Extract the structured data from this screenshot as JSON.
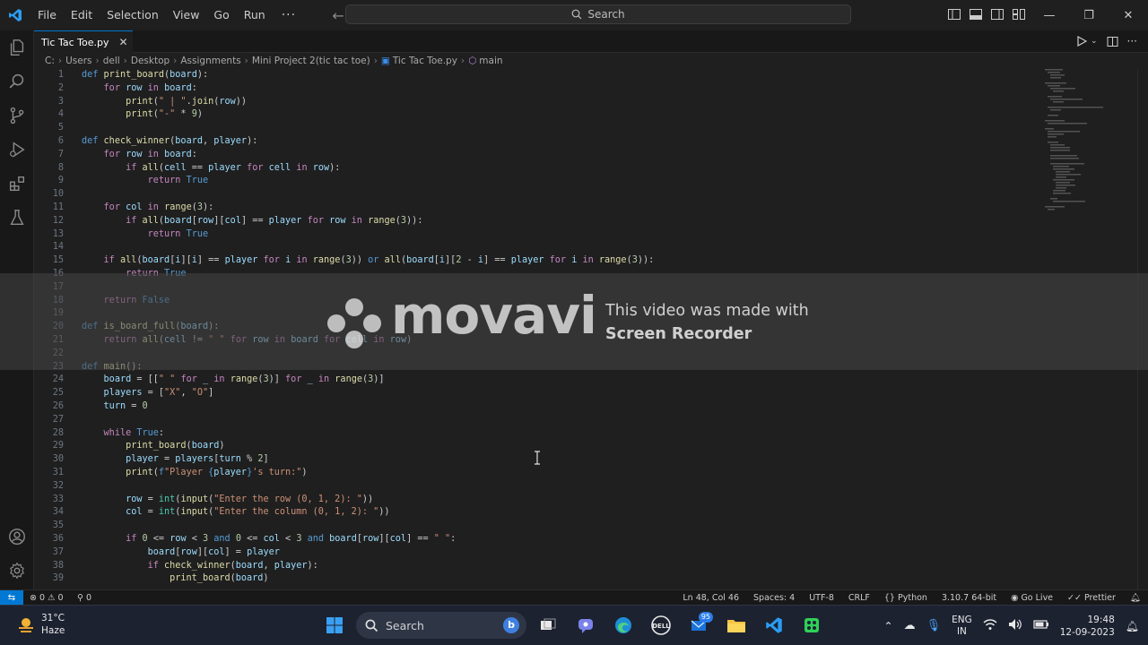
{
  "menu": [
    "File",
    "Edit",
    "Selection",
    "View",
    "Go",
    "Run"
  ],
  "menu_more": "···",
  "search_label": "Search",
  "tab": {
    "title": "Tic Tac Toe.py",
    "close": "✕"
  },
  "breadcrumb": [
    "C:",
    "Users",
    "dell",
    "Desktop",
    "Assignments",
    "Mini Project 2(tic tac toe)",
    "Tic Tac Toe.py",
    "main"
  ],
  "code_lines": [
    {
      "n": "1",
      "html": "<span class='kw'>def</span> <span class='fn'>print_board</span>(<span class='var'>board</span>):"
    },
    {
      "n": "2",
      "html": "    <span class='ctl'>for</span> <span class='var'>row</span> <span class='ctl'>in</span> <span class='var'>board</span>:"
    },
    {
      "n": "3",
      "html": "        <span class='fn'>print</span>(<span class='str'>\" | \"</span>.<span class='fn'>join</span>(<span class='var'>row</span>))"
    },
    {
      "n": "4",
      "html": "        <span class='fn'>print</span>(<span class='str'>\"-\"</span> * <span class='num'>9</span>)"
    },
    {
      "n": "5",
      "html": ""
    },
    {
      "n": "6",
      "html": "<span class='kw'>def</span> <span class='fn'>check_winner</span>(<span class='var'>board</span>, <span class='var'>player</span>):"
    },
    {
      "n": "7",
      "html": "    <span class='ctl'>for</span> <span class='var'>row</span> <span class='ctl'>in</span> <span class='var'>board</span>:"
    },
    {
      "n": "8",
      "html": "        <span class='ctl'>if</span> <span class='fn'>all</span>(<span class='var'>cell</span> == <span class='var'>player</span> <span class='ctl'>for</span> <span class='var'>cell</span> <span class='ctl'>in</span> <span class='var'>row</span>):"
    },
    {
      "n": "9",
      "html": "            <span class='ctl'>return</span> <span class='kw'>True</span>"
    },
    {
      "n": "10",
      "html": ""
    },
    {
      "n": "11",
      "html": "    <span class='ctl'>for</span> <span class='var'>col</span> <span class='ctl'>in</span> <span class='fn'>range</span>(<span class='num'>3</span>):"
    },
    {
      "n": "12",
      "html": "        <span class='ctl'>if</span> <span class='fn'>all</span>(<span class='var'>board</span>[<span class='var'>row</span>][<span class='var'>col</span>] == <span class='var'>player</span> <span class='ctl'>for</span> <span class='var'>row</span> <span class='ctl'>in</span> <span class='fn'>range</span>(<span class='num'>3</span>)):"
    },
    {
      "n": "13",
      "html": "            <span class='ctl'>return</span> <span class='kw'>True</span>"
    },
    {
      "n": "14",
      "html": ""
    },
    {
      "n": "15",
      "html": "    <span class='ctl'>if</span> <span class='fn'>all</span>(<span class='var'>board</span>[<span class='var'>i</span>][<span class='var'>i</span>] == <span class='var'>player</span> <span class='ctl'>for</span> <span class='var'>i</span> <span class='ctl'>in</span> <span class='fn'>range</span>(<span class='num'>3</span>)) <span class='kw'>or</span> <span class='fn'>all</span>(<span class='var'>board</span>[<span class='var'>i</span>][<span class='num'>2</span> - <span class='var'>i</span>] == <span class='var'>player</span> <span class='ctl'>for</span> <span class='var'>i</span> <span class='ctl'>in</span> <span class='fn'>range</span>(<span class='num'>3</span>)):"
    },
    {
      "n": "16",
      "html": "        <span class='ctl'>return</span> <span class='kw'>True</span>"
    },
    {
      "n": "17",
      "html": ""
    },
    {
      "n": "18",
      "html": "    <span class='ctl'>return</span> <span class='kw'>False</span>"
    },
    {
      "n": "19",
      "html": ""
    },
    {
      "n": "20",
      "html": "<span class='kw'>def</span> <span class='fn'>is_board_full</span>(<span class='var'>board</span>):"
    },
    {
      "n": "21",
      "html": "    <span class='ctl'>return</span> <span class='fn'>all</span>(<span class='var'>cell</span> != <span class='str'>\" \"</span> <span class='ctl'>for</span> <span class='var'>row</span> <span class='ctl'>in</span> <span class='var'>board</span> <span class='ctl'>for</span> <span class='var'>cell</span> <span class='ctl'>in</span> <span class='var'>row</span>)"
    },
    {
      "n": "22",
      "html": ""
    },
    {
      "n": "23",
      "html": "<span class='kw'>def</span> <span class='fn'>main</span>():"
    },
    {
      "n": "24",
      "html": "    <span class='var'>board</span> = [[<span class='str'>\" \"</span> <span class='ctl'>for</span> <span class='var'>_</span> <span class='ctl'>in</span> <span class='fn'>range</span>(<span class='num'>3</span>)] <span class='ctl'>for</span> <span class='var'>_</span> <span class='ctl'>in</span> <span class='fn'>range</span>(<span class='num'>3</span>)]"
    },
    {
      "n": "25",
      "html": "    <span class='var'>players</span> = [<span class='str'>\"X\"</span>, <span class='str'>\"O\"</span>]"
    },
    {
      "n": "26",
      "html": "    <span class='var'>turn</span> = <span class='num'>0</span>"
    },
    {
      "n": "27",
      "html": ""
    },
    {
      "n": "28",
      "html": "    <span class='ctl'>while</span> <span class='kw'>True</span>:"
    },
    {
      "n": "29",
      "html": "        <span class='fn'>print_board</span>(<span class='var'>board</span>)"
    },
    {
      "n": "30",
      "html": "        <span class='var'>player</span> = <span class='var'>players</span>[<span class='var'>turn</span> % <span class='num'>2</span>]"
    },
    {
      "n": "31",
      "html": "        <span class='fn'>print</span>(<span class='kw'>f</span><span class='str'>\"Player </span><span class='kw'>{</span><span class='var'>player</span><span class='kw'>}</span><span class='str'>'s turn:\"</span>)"
    },
    {
      "n": "32",
      "html": ""
    },
    {
      "n": "33",
      "html": "        <span class='var'>row</span> = <span class='cls'>int</span>(<span class='fn'>input</span>(<span class='str'>\"Enter the row (0, 1, 2): \"</span>))"
    },
    {
      "n": "34",
      "html": "        <span class='var'>col</span> = <span class='cls'>int</span>(<span class='fn'>input</span>(<span class='str'>\"Enter the column (0, 1, 2): \"</span>))"
    },
    {
      "n": "35",
      "html": ""
    },
    {
      "n": "36",
      "html": "        <span class='ctl'>if</span> <span class='num'>0</span> &lt;= <span class='var'>row</span> &lt; <span class='num'>3</span> <span class='kw'>and</span> <span class='num'>0</span> &lt;= <span class='var'>col</span> &lt; <span class='num'>3</span> <span class='kw'>and</span> <span class='var'>board</span>[<span class='var'>row</span>][<span class='var'>col</span>] == <span class='str'>\" \"</span>:"
    },
    {
      "n": "37",
      "html": "            <span class='var'>board</span>[<span class='var'>row</span>][<span class='var'>col</span>] = <span class='var'>player</span>"
    },
    {
      "n": "38",
      "html": "            <span class='ctl'>if</span> <span class='fn'>check_winner</span>(<span class='var'>board</span>, <span class='var'>player</span>):"
    },
    {
      "n": "39",
      "html": "                <span class='fn'>print_board</span>(<span class='var'>board</span>)"
    }
  ],
  "watermark": {
    "brand": "movavi",
    "line1": "This video was made with",
    "line2": "Screen Recorder"
  },
  "status": {
    "errors": "0",
    "warnings": "0",
    "ports": "0",
    "position": "Ln 48, Col 46",
    "spaces": "Spaces: 4",
    "encoding": "UTF-8",
    "eol": "CRLF",
    "language": "Python",
    "interpreter": "3.10.7 64-bit",
    "golive": "Go Live",
    "prettier": "Prettier"
  },
  "taskbar": {
    "temperature": "31°C",
    "weather": "Haze",
    "search": "Search",
    "mail_badge": "95",
    "lang1": "ENG",
    "lang2": "IN",
    "time": "19:48",
    "date": "12-09-2023"
  },
  "colors": {
    "accent": "#0078d4",
    "keyword": "#569cd6",
    "control": "#c586c0",
    "function": "#dcdcaa",
    "string": "#ce9178",
    "number": "#b5cea8",
    "variable": "#9cdcfe"
  }
}
